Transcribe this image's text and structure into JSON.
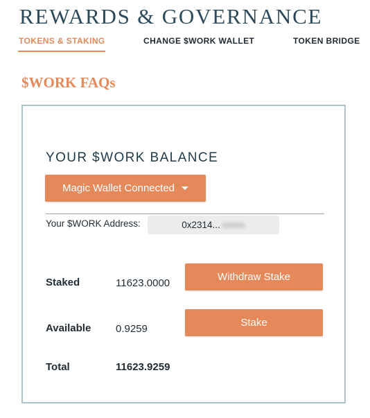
{
  "header": {
    "title": "REWARDS & GOVERNANCE",
    "tabs": [
      {
        "label": "TOKENS & STAKING",
        "active": true
      },
      {
        "label": "CHANGE $WORK WALLET",
        "active": false
      },
      {
        "label": "TOKEN BRIDGE",
        "active": false
      }
    ]
  },
  "faq_link": "$WORK FAQs",
  "balance": {
    "heading": "YOUR $WORK BALANCE",
    "wallet_button": "Magic Wallet Connected",
    "address_label": "Your $WORK Address:",
    "address_value": "0x2314...",
    "rows": [
      {
        "label": "Staked",
        "value": "11623.0000"
      },
      {
        "label": "Available",
        "value": "0.9259"
      },
      {
        "label": "Total",
        "value": "11623.9259"
      }
    ],
    "withdraw_button": "Withdraw Stake",
    "stake_button": "Stake"
  },
  "colors": {
    "accent": "#e6895a",
    "title": "#2c4a5c",
    "card_border": "#aec4cc"
  }
}
